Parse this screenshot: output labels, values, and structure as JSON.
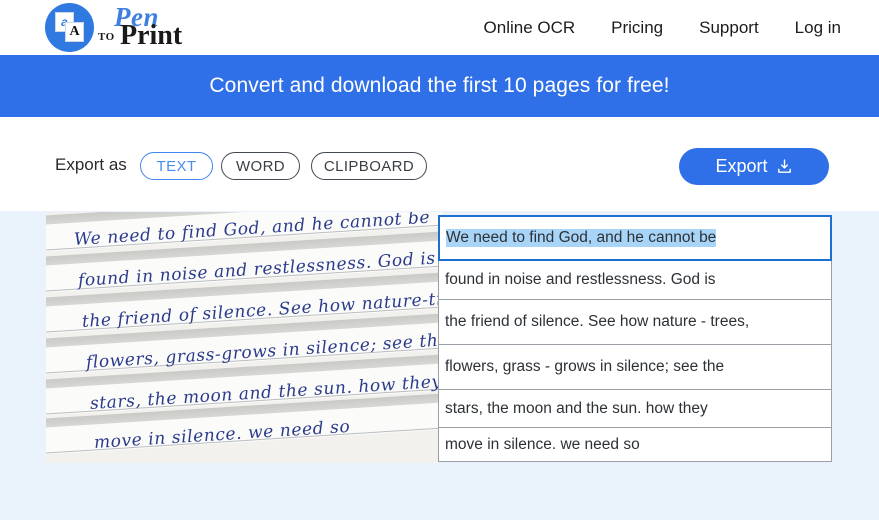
{
  "header": {
    "logo": {
      "mark_back_letter": "a",
      "mark_front_letter": "A",
      "word_pen": "Pen",
      "word_to": "TO",
      "word_print": "Print"
    },
    "nav": [
      {
        "label": "Online OCR"
      },
      {
        "label": "Pricing"
      },
      {
        "label": "Support"
      },
      {
        "label": "Log in"
      }
    ]
  },
  "banner": {
    "text": "Convert and download the first 10 pages for free!",
    "bg_color": "#2f70e8"
  },
  "toolbar": {
    "export_as_label": "Export as",
    "formats": [
      {
        "label": "TEXT",
        "selected": true
      },
      {
        "label": "WORD",
        "selected": false
      },
      {
        "label": "CLIPBOARD",
        "selected": false
      }
    ],
    "export_button_label": "Export",
    "export_button_color": "#2f70e8",
    "active_pill_color": "#4a8cf2"
  },
  "document": {
    "scan_alt": "handwritten cursive note on ruled paper",
    "handwriting_lines": [
      "We need to find God, and he cannot be",
      "found in noise and restlessness. God is",
      "the friend of silence. See how nature-trees,",
      "flowers, grass-grows in silence; see the",
      "stars, the moon and the sun. how they",
      "move in silence. we need so"
    ],
    "ink_color": "#2b3b8c"
  },
  "ocr_rows": [
    {
      "text": "We need to find God, and he cannot be",
      "selected": true
    },
    {
      "text": "found in noise and restlessness. God is",
      "selected": false
    },
    {
      "text": "the friend of silence. See how nature - trees,",
      "selected": false
    },
    {
      "text": "flowers, grass - grows in silence; see the",
      "selected": false
    },
    {
      "text": "stars, the moon and the sun. how they",
      "selected": false
    },
    {
      "text": "move in silence. we need so",
      "selected": false
    }
  ],
  "colors": {
    "accent": "#2f70e8",
    "content_bg": "#eaf2fc",
    "selection_highlight": "#a8d4f7",
    "active_row_border": "#1d6fd0"
  }
}
